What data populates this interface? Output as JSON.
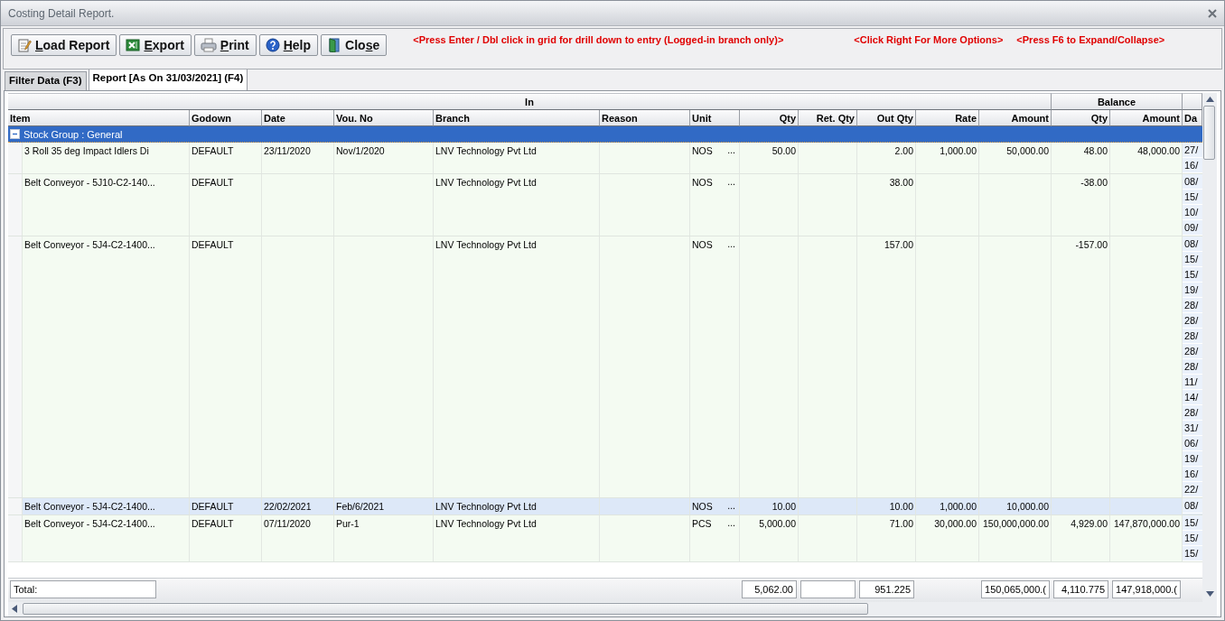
{
  "window": {
    "title": "Costing Detail Report."
  },
  "toolbar": {
    "buttons": [
      {
        "kind": "load",
        "label": {
          "key": "L",
          "after": "oad Report"
        }
      },
      {
        "kind": "export",
        "label": {
          "key": "E",
          "after": "xport"
        }
      },
      {
        "kind": "print",
        "label": {
          "key": "P",
          "after": "rint"
        }
      },
      {
        "kind": "help",
        "label": {
          "key": "H",
          "after": "elp"
        }
      },
      {
        "kind": "close",
        "label": {
          "before": "Clo",
          "key": "s",
          "after": "e"
        }
      }
    ],
    "hints": [
      "<Press Enter / Dbl click in grid for drill down to entry (Logged-in branch only)>",
      "<Click Right For More Options>",
      "<Press F6 to Expand/Collapse>"
    ]
  },
  "tabs": [
    {
      "label": "Filter Data (F3)",
      "selected": false
    },
    {
      "label": "Report [As On 31/03/2021] (F4)",
      "selected": true
    }
  ],
  "grid": {
    "header_groups": [
      "In",
      "Balance"
    ],
    "columns": [
      "Item",
      "Godown",
      "Date",
      "Vou. No",
      "Branch",
      "Reason",
      "Unit",
      "Qty",
      "Ret. Qty",
      "Out Qty",
      "Rate",
      "Amount",
      "Qty",
      "Amount",
      "Da"
    ],
    "group_row": {
      "label": "Stock Group : General",
      "expanded": true
    },
    "rows": [
      {
        "selected": false,
        "item": "3 Roll 35 deg Impact Idlers Di",
        "godown": "DEFAULT",
        "date": "23/11/2020",
        "vou_no": "Nov/1/2020",
        "branch": "LNV Technology Pvt Ltd",
        "unit": "NOS",
        "unit_button": "...",
        "qty": "50.00",
        "out_qty": "2.00",
        "rate": "1,000.00",
        "amount": "50,000.00",
        "bal_qty": "48.00",
        "bal_amount": "48,000.00",
        "dates": [
          "27/",
          "16/"
        ]
      },
      {
        "selected": false,
        "item": "Belt Conveyor - 5J10-C2-140...",
        "godown": "DEFAULT",
        "branch": "LNV Technology Pvt Ltd",
        "unit": "NOS",
        "unit_button": "...",
        "out_qty": "38.00",
        "bal_qty": "-38.00",
        "dates": [
          "08/",
          "15/",
          "10/",
          "09/"
        ]
      },
      {
        "selected": false,
        "item": "Belt Conveyor - 5J4-C2-1400...",
        "godown": "DEFAULT",
        "branch": "LNV Technology Pvt Ltd",
        "unit": "NOS",
        "unit_button": "...",
        "out_qty": "157.00",
        "bal_qty": "-157.00",
        "dates": [
          "08/",
          "15/",
          "15/",
          "19/",
          "28/",
          "28/",
          "28/",
          "28/",
          "28/",
          "11/",
          "14/",
          "28/",
          "31/",
          "06/",
          "19/",
          "16/",
          "22/"
        ]
      },
      {
        "selected": true,
        "item": "Belt Conveyor - 5J4-C2-1400...",
        "godown": "DEFAULT",
        "date": "22/02/2021",
        "vou_no": "Feb/6/2021",
        "branch": "LNV Technology Pvt Ltd",
        "unit": "NOS",
        "unit_button": "...",
        "qty": "10.00",
        "out_qty": "10.00",
        "rate": "1,000.00",
        "amount": "10,000.00",
        "dates": [
          "08/"
        ]
      },
      {
        "selected": false,
        "item": "Belt Conveyor - 5J4-C2-1400...",
        "godown": "DEFAULT",
        "date": "07/11/2020",
        "vou_no": "Pur-1",
        "branch": "LNV Technology Pvt Ltd",
        "unit": "PCS",
        "unit_button": "...",
        "qty": "5,000.00",
        "out_qty": "71.00",
        "rate": "30,000.00",
        "amount": "150,000,000.00",
        "bal_qty": "4,929.00",
        "bal_amount": "147,870,000.00",
        "dates": [
          "15/",
          "15/",
          "15/"
        ]
      }
    ],
    "totals": {
      "label": "Total:",
      "qty": "5,062.00",
      "out_qty": "951.225",
      "amount": "150,065,000.(",
      "bal_qty": "4,110.775",
      "bal_amount": "147,918,000.("
    }
  }
}
